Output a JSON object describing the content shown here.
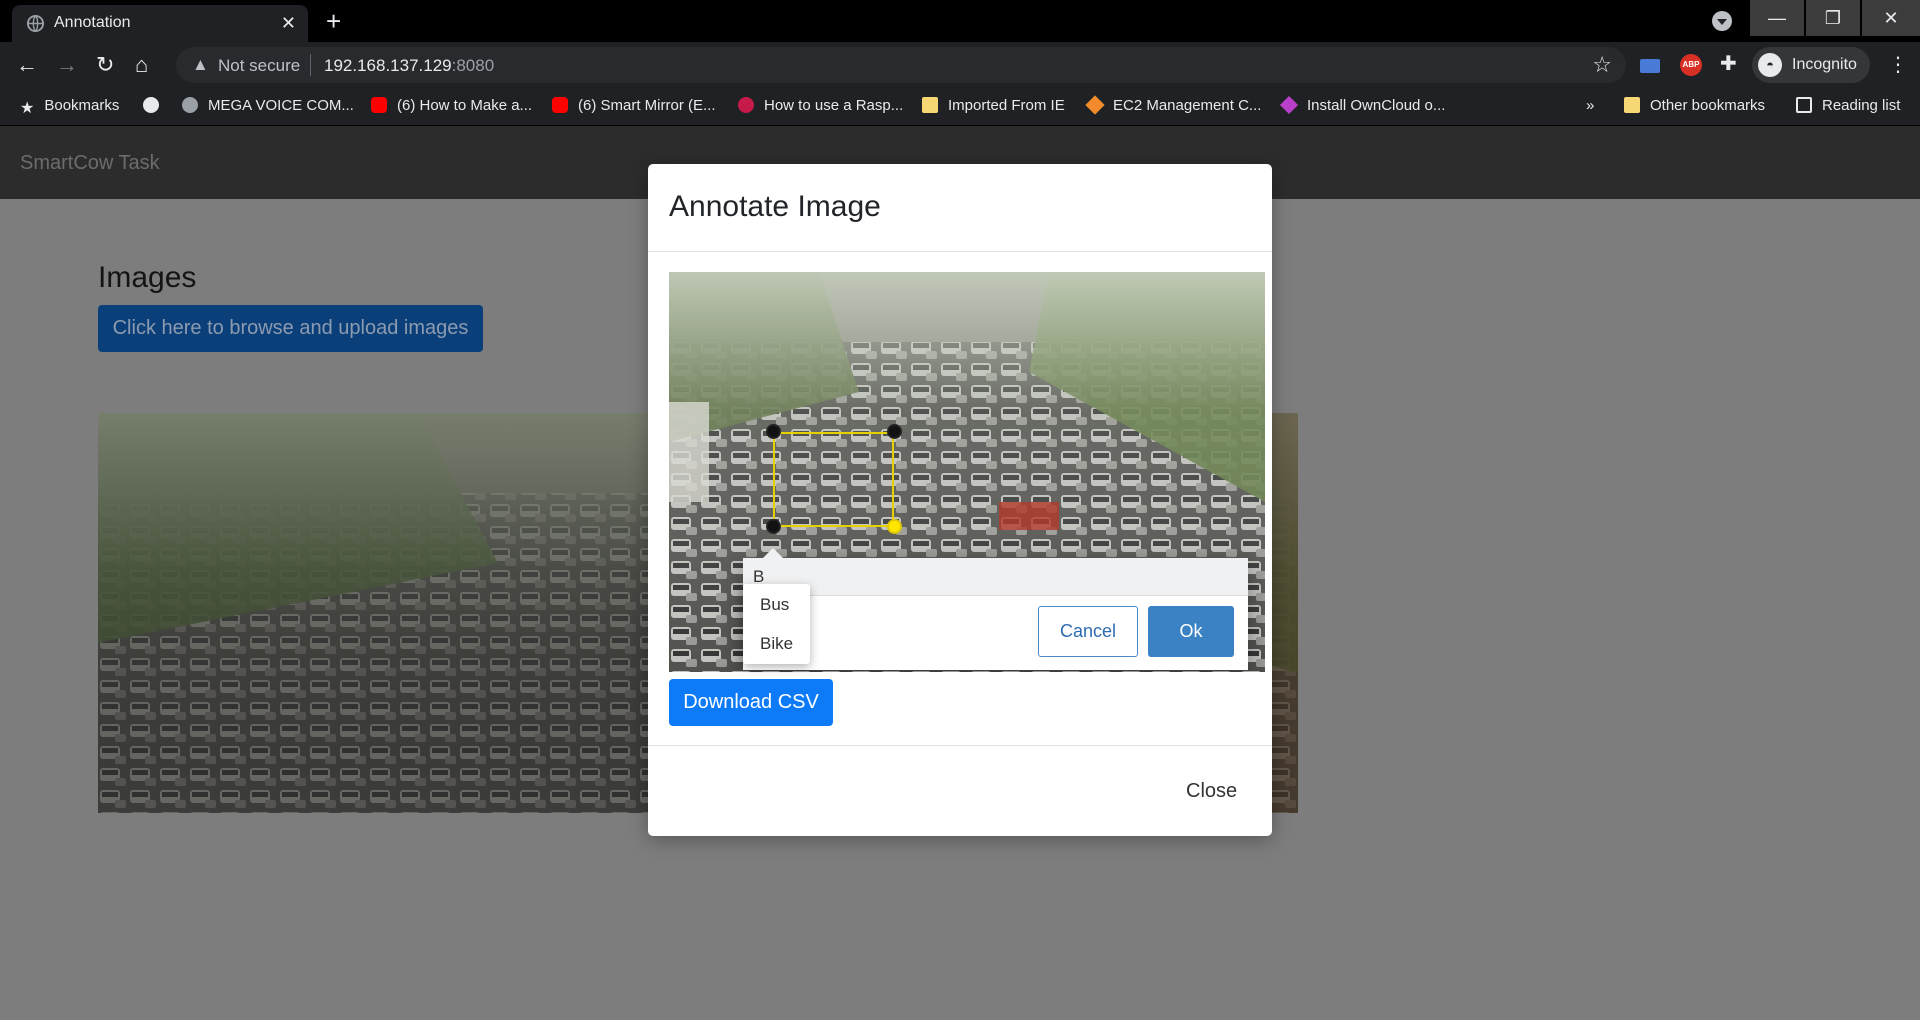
{
  "browser": {
    "tab_title": "Annotation",
    "address": {
      "security_label": "Not secure",
      "host": "192.168.137.129",
      "port": ":8080"
    },
    "profile_label": "Incognito",
    "bookmarks": [
      {
        "icon": "star-icon",
        "label": "Bookmarks"
      },
      {
        "icon": "globe-icon",
        "label": ""
      },
      {
        "icon": "mega-icon",
        "label": "MEGA VOICE COM..."
      },
      {
        "icon": "youtube-icon",
        "label": "(6) How to Make a..."
      },
      {
        "icon": "youtube-icon",
        "label": "(6) Smart Mirror (E..."
      },
      {
        "icon": "raspberry-icon",
        "label": "How to use a Rasp..."
      },
      {
        "icon": "folder-icon",
        "label": "Imported From IE"
      },
      {
        "icon": "aws-icon",
        "label": "EC2 Management C..."
      },
      {
        "icon": "owncloud-icon",
        "label": "Install OwnCloud o..."
      }
    ],
    "overflow_label": "»",
    "other_bookmarks": "Other bookmarks",
    "reading_list": "Reading list"
  },
  "page": {
    "brand": "SmartCow Task",
    "images_heading": "Images",
    "upload_button": "Click here to browse and upload images"
  },
  "modal": {
    "title": "Annotate Image",
    "label_input_value": "B",
    "suggestions": [
      "Bus",
      "Bike"
    ],
    "cancel_label": "Cancel",
    "ok_label": "Ok",
    "download_label": "Download CSV",
    "close_label": "Close"
  },
  "colors": {
    "primary_button": "#0d7bf7",
    "bbox_stroke": "#e6d100",
    "handle_active": "#ffe600"
  }
}
